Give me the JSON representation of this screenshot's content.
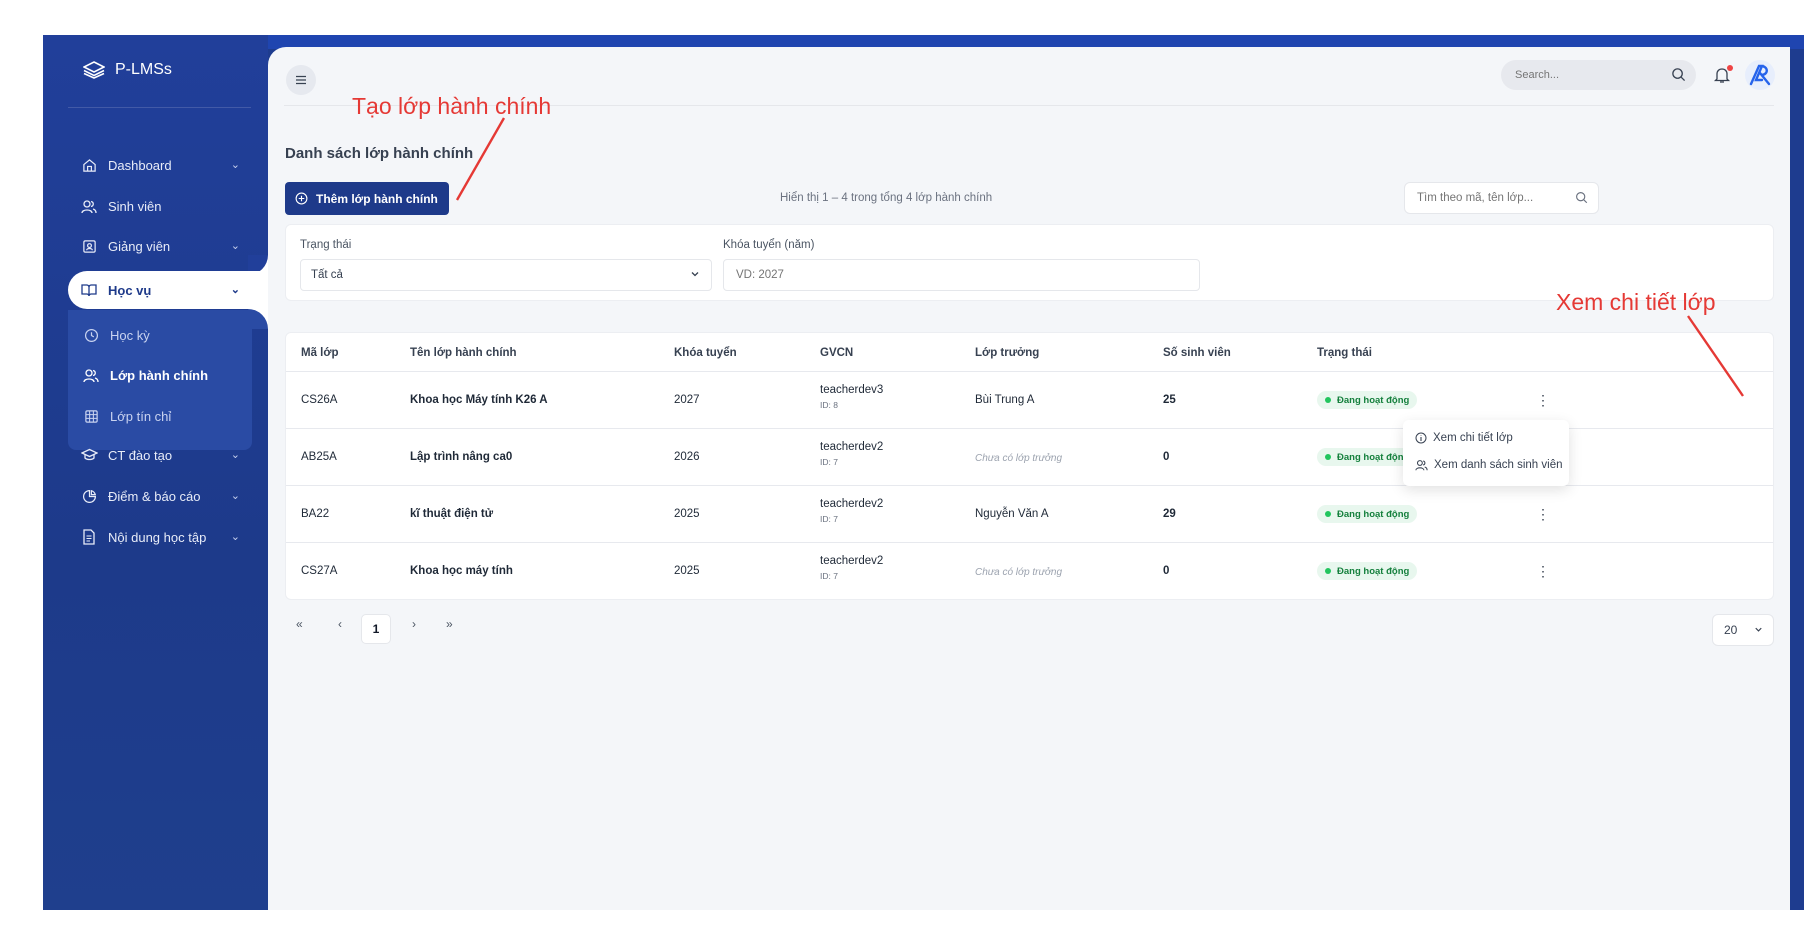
{
  "sidebar": {
    "brand": "P-LMSs",
    "items": [
      {
        "label": "Dashboard"
      },
      {
        "label": "Sinh viên"
      },
      {
        "label": "Giảng viên"
      },
      {
        "label": "Học vụ"
      },
      {
        "label": "Học kỳ"
      },
      {
        "label": "Lớp hành chính"
      },
      {
        "label": "Lớp tín chỉ"
      },
      {
        "label": "CT đào tạo"
      },
      {
        "label": "Điểm & báo cáo"
      },
      {
        "label": "Nội dung học tập"
      }
    ]
  },
  "topbar": {
    "search_placeholder": "Search...",
    "notification_dot_color": "#ef4444"
  },
  "page": {
    "title": "Danh sách lớp hành chính",
    "add_button": "Thêm lớp hành chính",
    "result_info": "Hiển thị 1 – 4 trong tổng 4 lớp hành chính",
    "search_placeholder": "Tìm theo mã, tên lớp..."
  },
  "filters": {
    "status_label": "Trạng thái",
    "status_value": "Tất cả",
    "year_label": "Khóa tuyển (năm)",
    "year_placeholder": "VD: 2027"
  },
  "table": {
    "columns": [
      "Mã lớp",
      "Tên lớp hành chính",
      "Khóa tuyển",
      "GVCN",
      "Lớp trưởng",
      "Số sinh viên",
      "Trạng thái"
    ],
    "rows": [
      {
        "code": "CS26A",
        "name": "Khoa học Máy tính K26 A",
        "year": "2027",
        "teacher": "teacherdev3",
        "teacher_id": "ID: 8",
        "monitor": "Bùi Trung A",
        "students": "25",
        "status": "Đang hoạt động"
      },
      {
        "code": "AB25A",
        "name": "Lập trình nâng ca0",
        "year": "2026",
        "teacher": "teacherdev2",
        "teacher_id": "ID: 7",
        "monitor": "Chưa có lớp trưởng",
        "students": "0",
        "status": "Đang hoạt động"
      },
      {
        "code": "BA22",
        "name": "kĩ thuật điện tử",
        "year": "2025",
        "teacher": "teacherdev2",
        "teacher_id": "ID: 7",
        "monitor": "Nguyễn Văn A",
        "students": "29",
        "status": "Đang hoạt động"
      },
      {
        "code": "CS27A",
        "name": "Khoa học máy tính",
        "year": "2025",
        "teacher": "teacherdev2",
        "teacher_id": "ID: 7",
        "monitor": "Chưa có lớp trưởng",
        "students": "0",
        "status": "Đang hoạt động"
      }
    ]
  },
  "row_menu": {
    "view_detail": "Xem chi tiết lớp",
    "view_students": "Xem danh sách sinh viên"
  },
  "pagination": {
    "first": "«",
    "prev": "‹",
    "current_page": "1",
    "next": "›",
    "last": "»",
    "page_size": "20"
  },
  "annotations": {
    "create_class": "Tạo lớp hành chính",
    "view_class_detail": "Xem chi tiết lớp",
    "color": "#e53935"
  },
  "colors": {
    "sidebar": "#1e3c8f",
    "primary": "#1e3a8a",
    "status_active": "#15803d"
  }
}
